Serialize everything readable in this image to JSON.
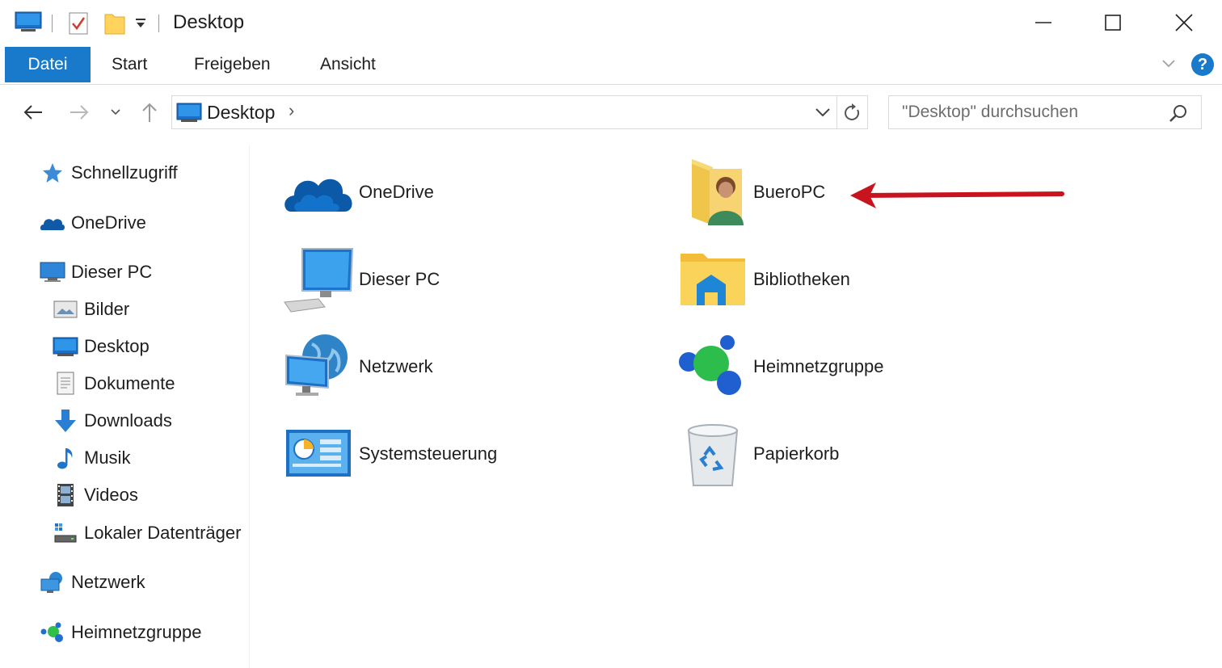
{
  "window": {
    "title": "Desktop",
    "minimize_glyph": "—",
    "maximize_glyph": "☐",
    "close_glyph": "✕"
  },
  "ribbon": {
    "tabs": [
      {
        "label": "Datei",
        "active": true
      },
      {
        "label": "Start"
      },
      {
        "label": "Freigeben"
      },
      {
        "label": "Ansicht"
      }
    ],
    "help_glyph": "?"
  },
  "address": {
    "path": "Desktop",
    "chevron": "›",
    "search_placeholder": "\"Desktop\" durchsuchen"
  },
  "sidebar": {
    "items": [
      {
        "label": "Schnellzugriff",
        "icon": "star-icon"
      },
      {
        "label": "OneDrive",
        "icon": "onedrive-icon"
      },
      {
        "label": "Dieser PC",
        "icon": "computer-icon"
      },
      {
        "label": "Bilder",
        "icon": "pictures-icon"
      },
      {
        "label": "Desktop",
        "icon": "desktop-icon"
      },
      {
        "label": "Dokumente",
        "icon": "documents-icon"
      },
      {
        "label": "Downloads",
        "icon": "download-arrow-icon"
      },
      {
        "label": "Musik",
        "icon": "music-note-icon"
      },
      {
        "label": "Videos",
        "icon": "film-icon"
      },
      {
        "label": "Lokaler Datenträger",
        "icon": "drive-icon"
      },
      {
        "label": "Netzwerk",
        "icon": "network-icon"
      },
      {
        "label": "Heimnetzgruppe",
        "icon": "homegroup-icon"
      }
    ]
  },
  "content": {
    "items": [
      {
        "label": "OneDrive",
        "icon": "onedrive-cloud-icon"
      },
      {
        "label": "BueroPC",
        "icon": "user-folder-icon"
      },
      {
        "label": "Dieser PC",
        "icon": "computer-icon"
      },
      {
        "label": "Bibliotheken",
        "icon": "libraries-icon"
      },
      {
        "label": "Netzwerk",
        "icon": "network-globe-icon"
      },
      {
        "label": "Heimnetzgruppe",
        "icon": "homegroup-icon"
      },
      {
        "label": "Systemsteuerung",
        "icon": "control-panel-icon"
      },
      {
        "label": "Papierkorb",
        "icon": "recycle-bin-icon"
      }
    ]
  },
  "colors": {
    "accent": "#1979ca",
    "annotation_arrow": "#c8141e"
  }
}
